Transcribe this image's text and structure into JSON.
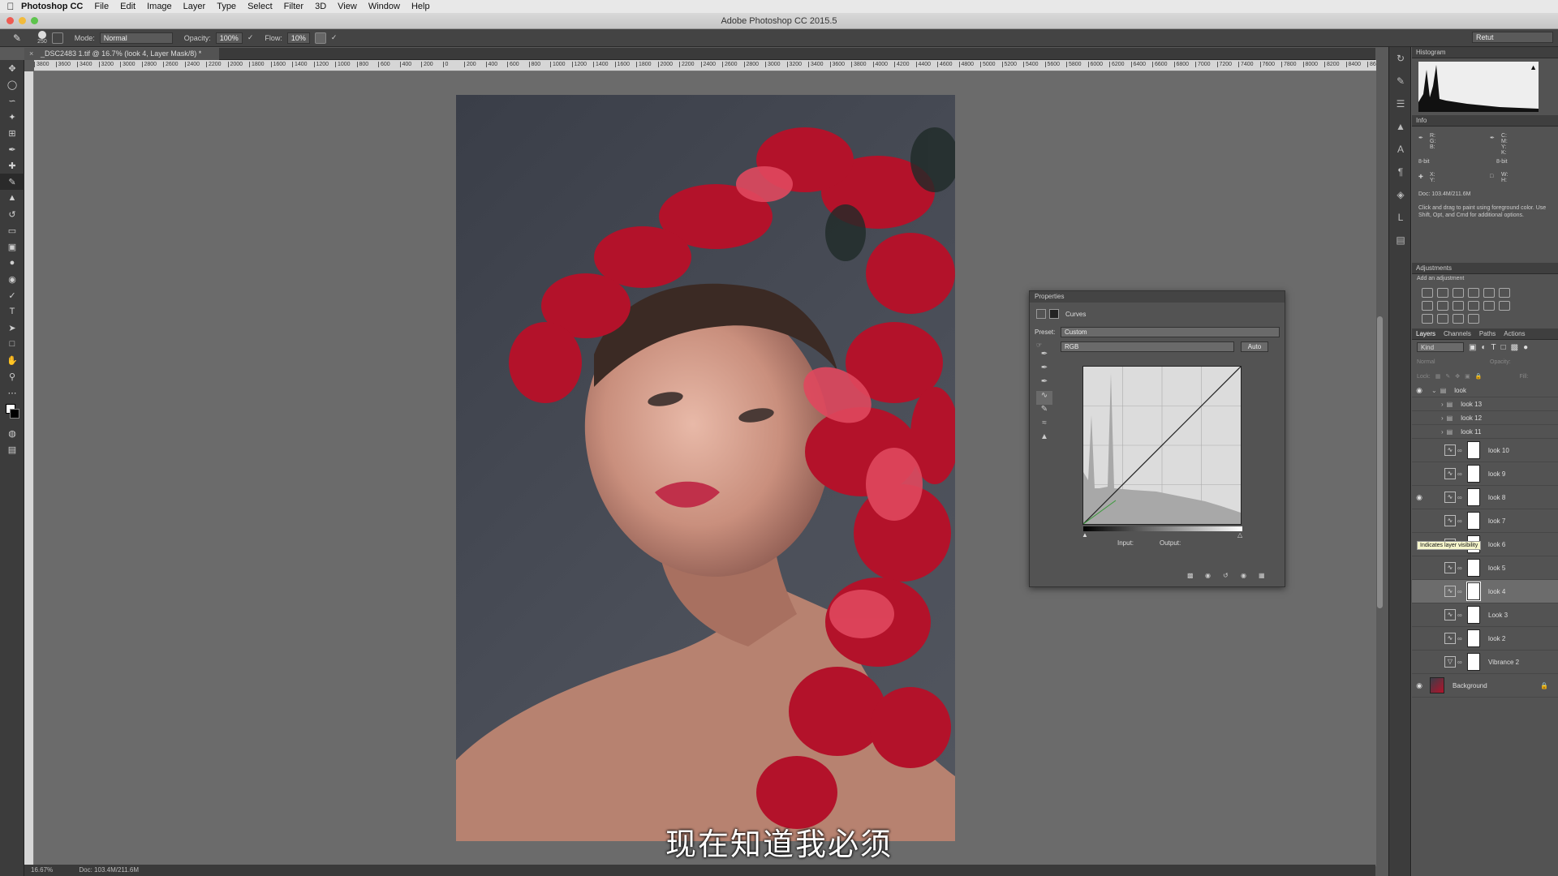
{
  "menubar": {
    "apple": "",
    "app_name": "Photoshop CC",
    "items": [
      "File",
      "Edit",
      "Image",
      "Layer",
      "Type",
      "Select",
      "Filter",
      "3D",
      "View",
      "Window",
      "Help"
    ]
  },
  "window": {
    "title": "Adobe Photoshop CC 2015.5"
  },
  "options_bar": {
    "brush_size": "250",
    "mode_label": "Mode:",
    "mode_value": "Normal",
    "opacity_label": "Opacity:",
    "opacity_value": "100%",
    "flow_label": "Flow:",
    "flow_value": "10%",
    "workspace": "Retut"
  },
  "document": {
    "tab_title": "_DSC2483 1.tif @ 16.7% (look 4, Layer Mask/8) *",
    "ruler_ticks": [
      "3800",
      "3600",
      "3400",
      "3200",
      "3000",
      "2800",
      "2600",
      "2400",
      "2200",
      "2000",
      "1800",
      "1600",
      "1400",
      "1200",
      "1000",
      "800",
      "600",
      "400",
      "200",
      "0",
      "200",
      "400",
      "600",
      "800",
      "1000",
      "1200",
      "1400",
      "1600",
      "1800",
      "2000",
      "2200",
      "2400",
      "2600",
      "2800",
      "3000",
      "3200",
      "3400",
      "3600",
      "3800",
      "4000",
      "4200",
      "4400",
      "4600",
      "4800",
      "5000",
      "5200",
      "5400",
      "5600",
      "5800",
      "6000",
      "6200",
      "6400",
      "6600",
      "6800",
      "7000",
      "7200",
      "7400",
      "7600",
      "7800",
      "8000",
      "8200",
      "8400",
      "8600",
      "8800"
    ],
    "zoom": "16.67%",
    "doc_size": "Doc: 103.4M/211.6M"
  },
  "subtitle": "现在知道我必须",
  "properties": {
    "panel_title": "Properties",
    "adjustment": "Curves",
    "preset_label": "Preset:",
    "preset_value": "Custom",
    "channel_value": "RGB",
    "auto_label": "Auto",
    "input_label": "Input:",
    "output_label": "Output:"
  },
  "histogram": {
    "title": "Histogram"
  },
  "info": {
    "title": "Info",
    "rgb_label": "R:\nG:\nB:",
    "cmyk_label": "C:\nM:\nY:\nK:",
    "bit_left": "8-bit",
    "bit_right": "8-bit",
    "xy_label": "X:\nY:",
    "wh_label": "W:\nH:",
    "doc": "Doc: 103.4M/211.6M",
    "hint": "Click and drag to paint using foreground color.  Use Shift, Opt, and Cmd for additional options."
  },
  "adjustments": {
    "title": "Adjustments",
    "subtitle": "Add an adjustment"
  },
  "layers_panel": {
    "tabs": [
      "Layers",
      "Channels",
      "Paths",
      "Actions"
    ],
    "kind_label": "Kind",
    "blend_mode": "Normal",
    "opacity_label": "Opacity:",
    "lock_label": "Lock:",
    "fill_label": "Fill:",
    "tooltip": "Indicates layer visibility",
    "layers": [
      {
        "name": "look",
        "type": "group",
        "visible": true
      },
      {
        "name": "look 13",
        "type": "group",
        "visible": false
      },
      {
        "name": "look 12",
        "type": "group",
        "visible": false
      },
      {
        "name": "look 11",
        "type": "group",
        "visible": false
      },
      {
        "name": "look 10",
        "type": "curves",
        "visible": false
      },
      {
        "name": "look 9",
        "type": "curves",
        "visible": false
      },
      {
        "name": "look 8",
        "type": "curves",
        "visible": true
      },
      {
        "name": "look 7",
        "type": "curves",
        "visible": false
      },
      {
        "name": "look 6",
        "type": "curves",
        "visible": false
      },
      {
        "name": "look 5",
        "type": "curves",
        "visible": false
      },
      {
        "name": "look 4",
        "type": "curves",
        "visible": false,
        "selected": true
      },
      {
        "name": "Look 3",
        "type": "curves",
        "visible": false
      },
      {
        "name": "look 2",
        "type": "curves",
        "visible": false
      },
      {
        "name": "Vibrance 2",
        "type": "vibrance",
        "visible": false
      },
      {
        "name": "Background",
        "type": "image",
        "visible": true
      }
    ]
  },
  "colors": {
    "accent": "#2f6fd6",
    "canvas_bg": "#6b6b6b",
    "panel_bg": "#535353"
  }
}
